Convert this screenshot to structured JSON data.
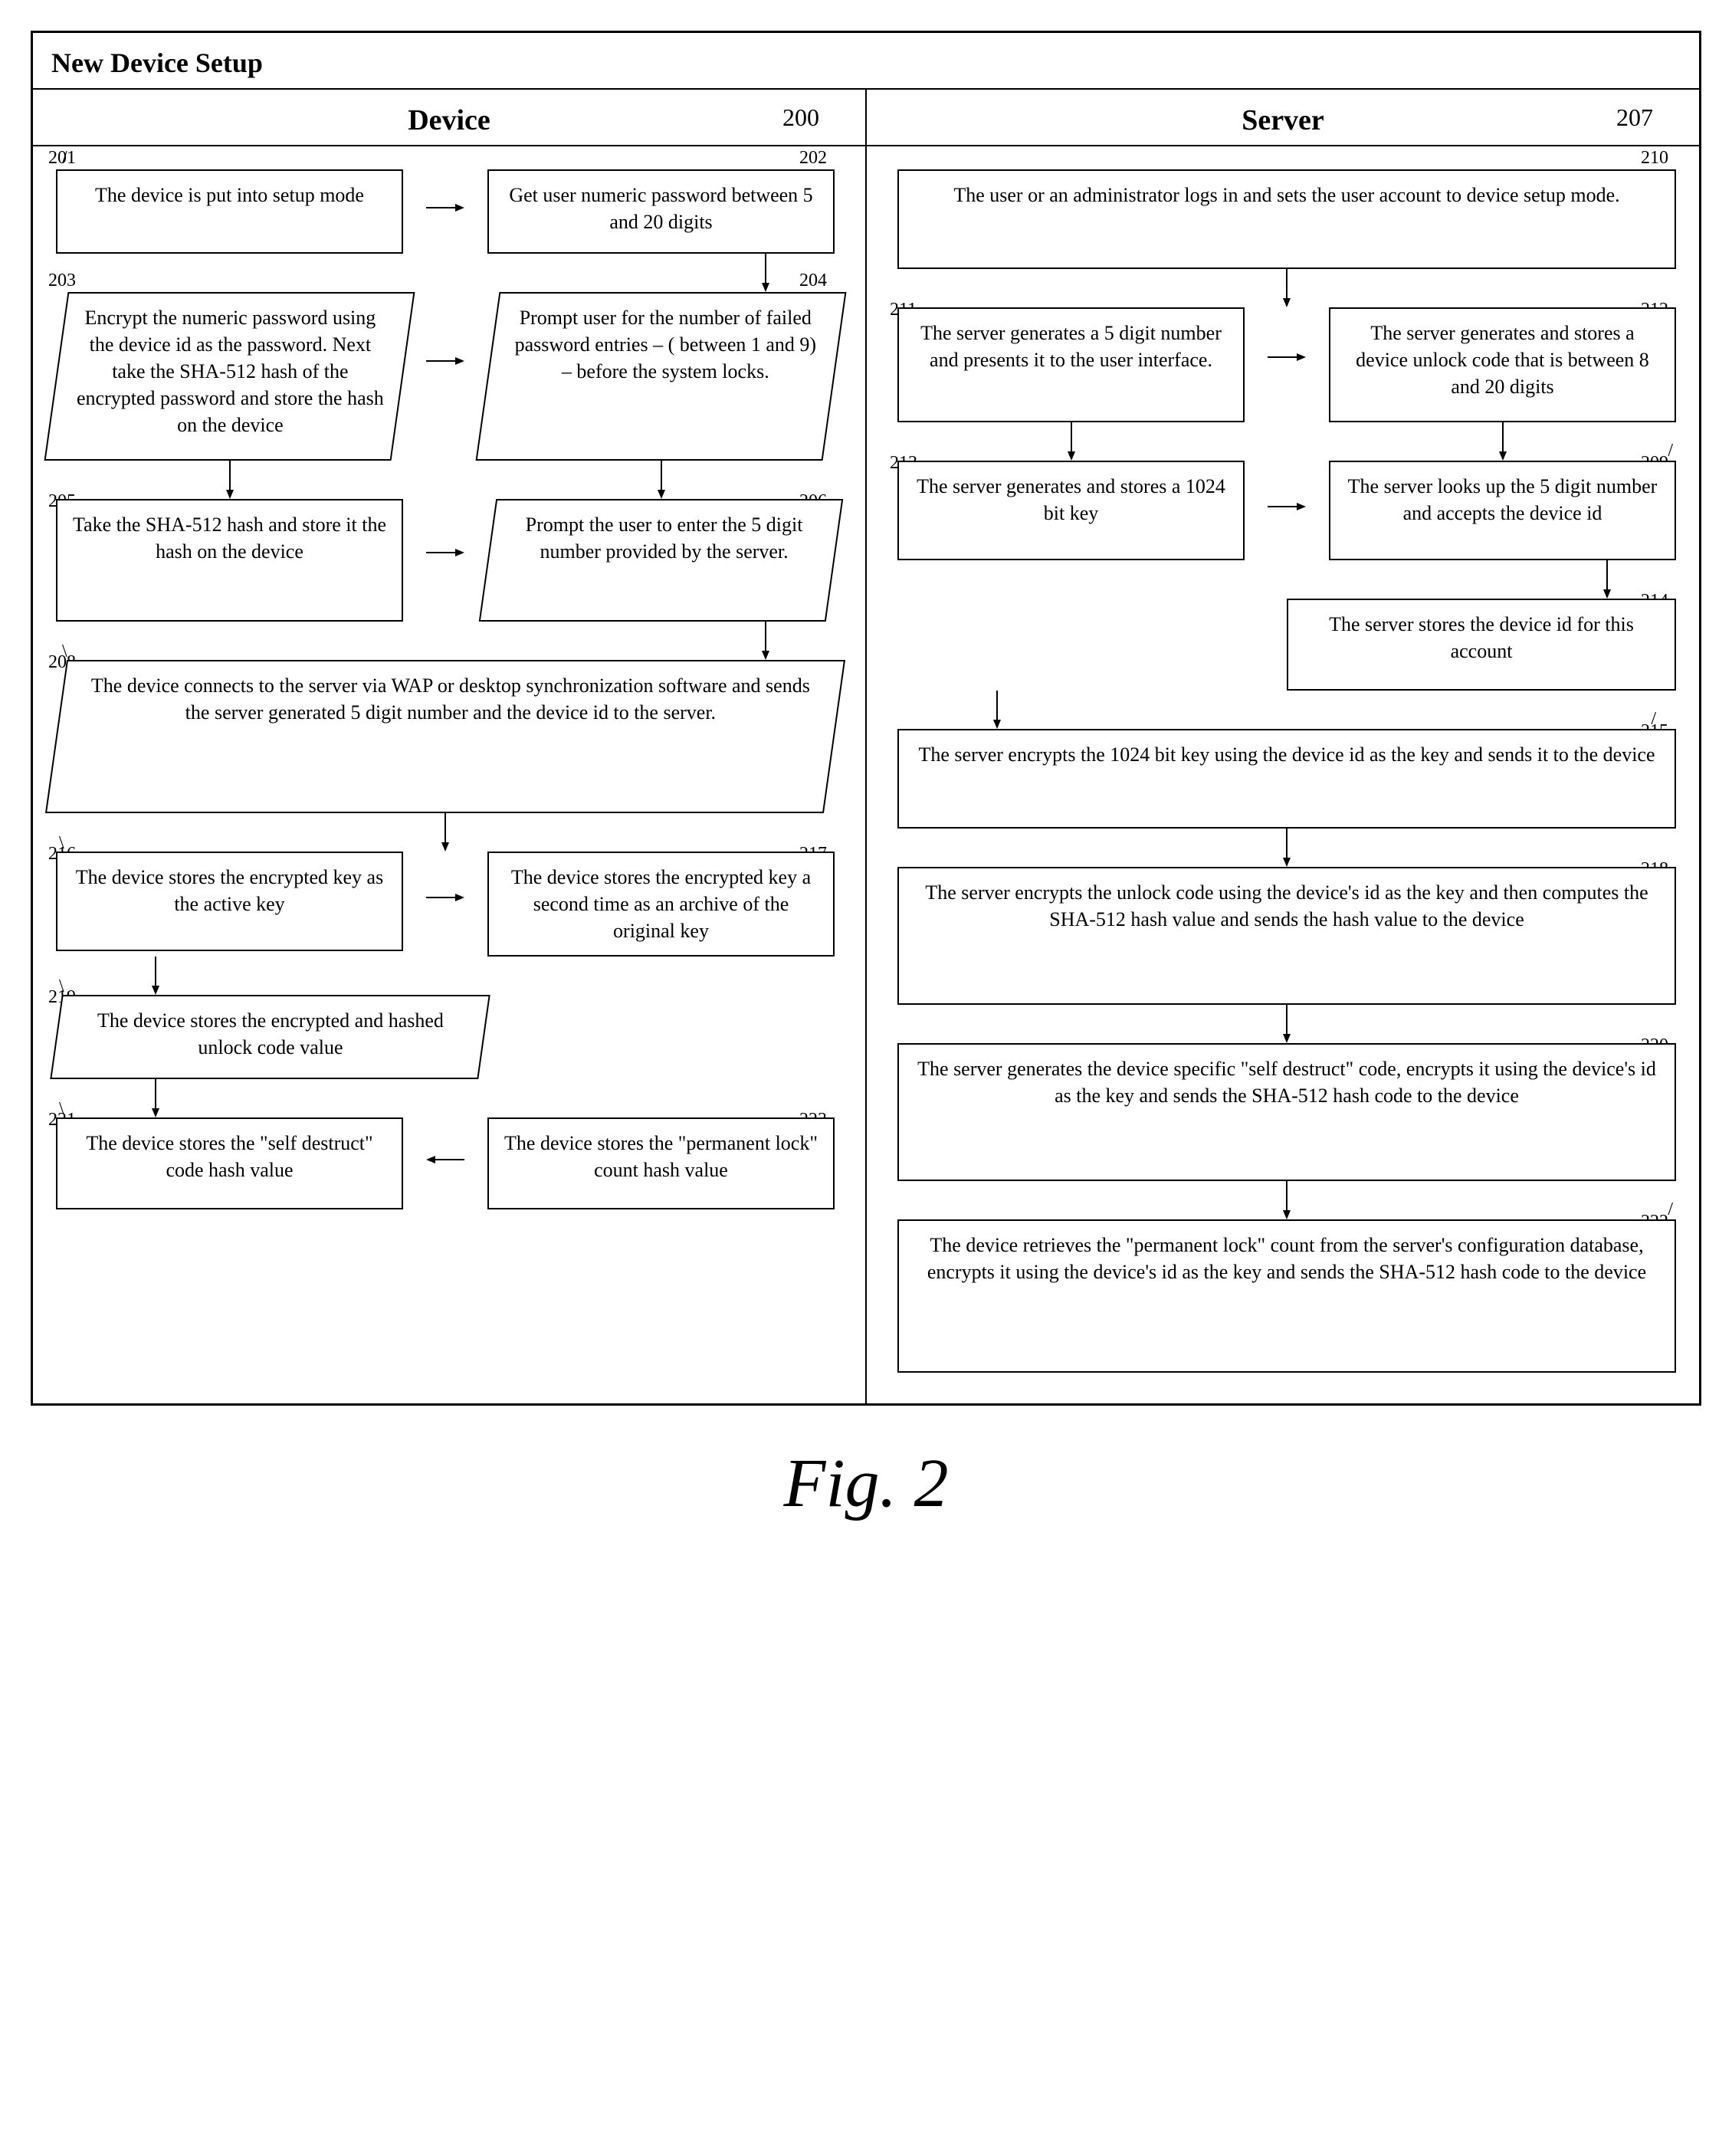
{
  "title": "New Device Setup",
  "figCaption": "Fig. 2",
  "columns": {
    "device": {
      "label": "Device",
      "number": "200"
    },
    "server": {
      "label": "Server",
      "number": "207"
    }
  },
  "nodes": {
    "n201": {
      "id": "201",
      "text": "The device is put into setup mode"
    },
    "n202": {
      "id": "202",
      "text": "Get user numeric password between 5 and 20 digits"
    },
    "n203": {
      "id": "203",
      "text": "Encrypt the numeric password using the device id as the password.  Next take the SHA-512 hash of the encrypted password and store the hash on the device"
    },
    "n204": {
      "id": "204",
      "text": "Prompt user for the number of failed password entries – ( between 1 and 9) – before the system locks."
    },
    "n205": {
      "id": "205",
      "text": "Take the SHA-512 hash and store it the hash on the device"
    },
    "n206": {
      "id": "206",
      "text": "Prompt the user to enter the 5 digit number provided by the server."
    },
    "n208": {
      "id": "208",
      "text": "The device connects to the server via WAP or desktop synchronization software and sends the server generated 5 digit number and the device id to the server."
    },
    "n216": {
      "id": "216",
      "text": "The device stores the encrypted key as the active key"
    },
    "n217": {
      "id": "217",
      "text": "The device stores the encrypted key a second time as an archive of the original key"
    },
    "n219": {
      "id": "219",
      "text": "The device stores the encrypted and hashed unlock code value"
    },
    "n221": {
      "id": "221",
      "text": "The device stores the \"self destruct\" code hash value"
    },
    "n223": {
      "id": "223",
      "text": "The device stores the \"permanent lock\" count hash value"
    },
    "n210": {
      "id": "210",
      "text": "The user or an administrator logs in and sets the user account to device setup mode."
    },
    "n211": {
      "id": "211",
      "text": "The server generates a 5 digit number and presents it to the user interface."
    },
    "n212": {
      "id": "212",
      "text": "The server generates and stores a device unlock code that is between 8 and 20 digits"
    },
    "n213": {
      "id": "213",
      "text": "The server generates and stores a 1024 bit key"
    },
    "n209": {
      "id": "209",
      "text": "The server looks up the 5 digit number and accepts the device id"
    },
    "n214": {
      "id": "214",
      "text": "The server stores the device id for this account"
    },
    "n215": {
      "id": "215",
      "text": "The server encrypts the 1024 bit key using the device id as the key and sends it to the device"
    },
    "n218": {
      "id": "218",
      "text": "The server encrypts the unlock code using the device's id as the key and then computes the SHA-512 hash value and sends the hash value to the device"
    },
    "n220": {
      "id": "220",
      "text": "The server generates the device specific \"self destruct\" code, encrypts it using the device's id as the key and sends the SHA-512 hash code to the device"
    },
    "n222": {
      "id": "222",
      "text": "The device retrieves the \"permanent lock\" count from the server's configuration database, encrypts it using the device's id as the key and sends the SHA-512 hash code to the device"
    }
  }
}
